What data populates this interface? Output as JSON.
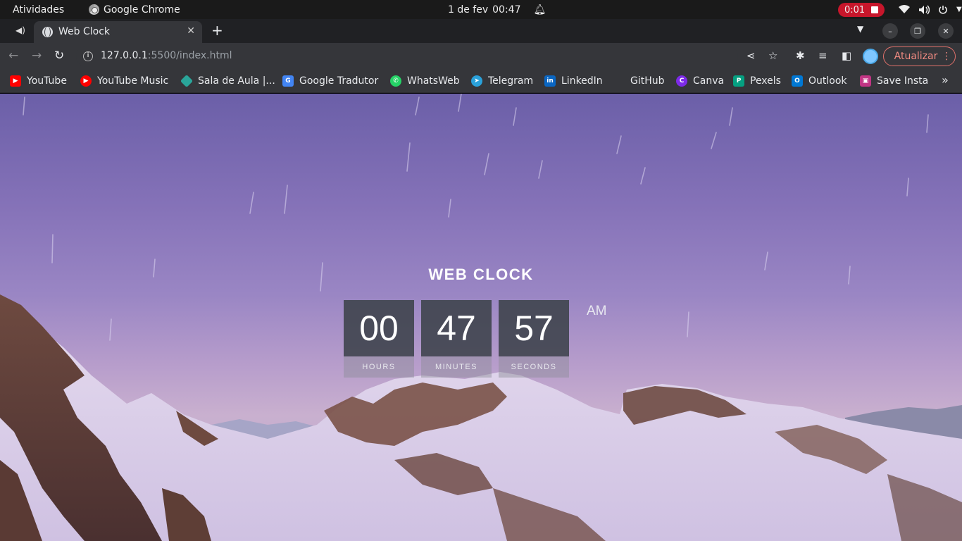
{
  "system_bar": {
    "activities": "Atividades",
    "app_name": "Google Chrome",
    "date": "1 de fev",
    "time": "00:47",
    "recording_time": "0:01"
  },
  "browser": {
    "tab_title": "Web Clock",
    "url_host": "127.0.0.1",
    "url_path": ":5500/index.html",
    "update_label": "Atualizar",
    "bookmarks": [
      {
        "label": "YouTube",
        "icon": "youtube-icon",
        "color": "#ff0000"
      },
      {
        "label": "YouTube Music",
        "icon": "youtube-music-icon",
        "color": "#ff0000"
      },
      {
        "label": "Sala de Aula |...",
        "icon": "classroom-icon",
        "color": "#2aa59a"
      },
      {
        "label": "Google Tradutor",
        "icon": "translate-icon",
        "color": "#4285f4"
      },
      {
        "label": "WhatsWeb",
        "icon": "whatsapp-icon",
        "color": "#25d366"
      },
      {
        "label": "Telegram",
        "icon": "telegram-icon",
        "color": "#2aa1da"
      },
      {
        "label": "LinkedIn",
        "icon": "linkedin-icon",
        "color": "#0a66c2"
      },
      {
        "label": "GitHub",
        "icon": "github-icon",
        "color": "#35363a"
      },
      {
        "label": "Canva",
        "icon": "canva-icon",
        "color": "#7d2ae8"
      },
      {
        "label": "Pexels",
        "icon": "pexels-icon",
        "color": "#05a081"
      },
      {
        "label": "Outlook",
        "icon": "outlook-icon",
        "color": "#0078d4"
      },
      {
        "label": "Save Insta",
        "icon": "saveinsta-icon",
        "color": "#c13584"
      }
    ]
  },
  "clock": {
    "title": "WEB CLOCK",
    "hours": "00",
    "minutes": "47",
    "seconds": "57",
    "hours_label": "HOURS",
    "minutes_label": "MINUTES",
    "seconds_label": "SECONDS",
    "period": "AM"
  },
  "colors": {
    "accent_red": "#c7162b",
    "update_button": "#f28b82",
    "clock_box": "#3c424a"
  }
}
